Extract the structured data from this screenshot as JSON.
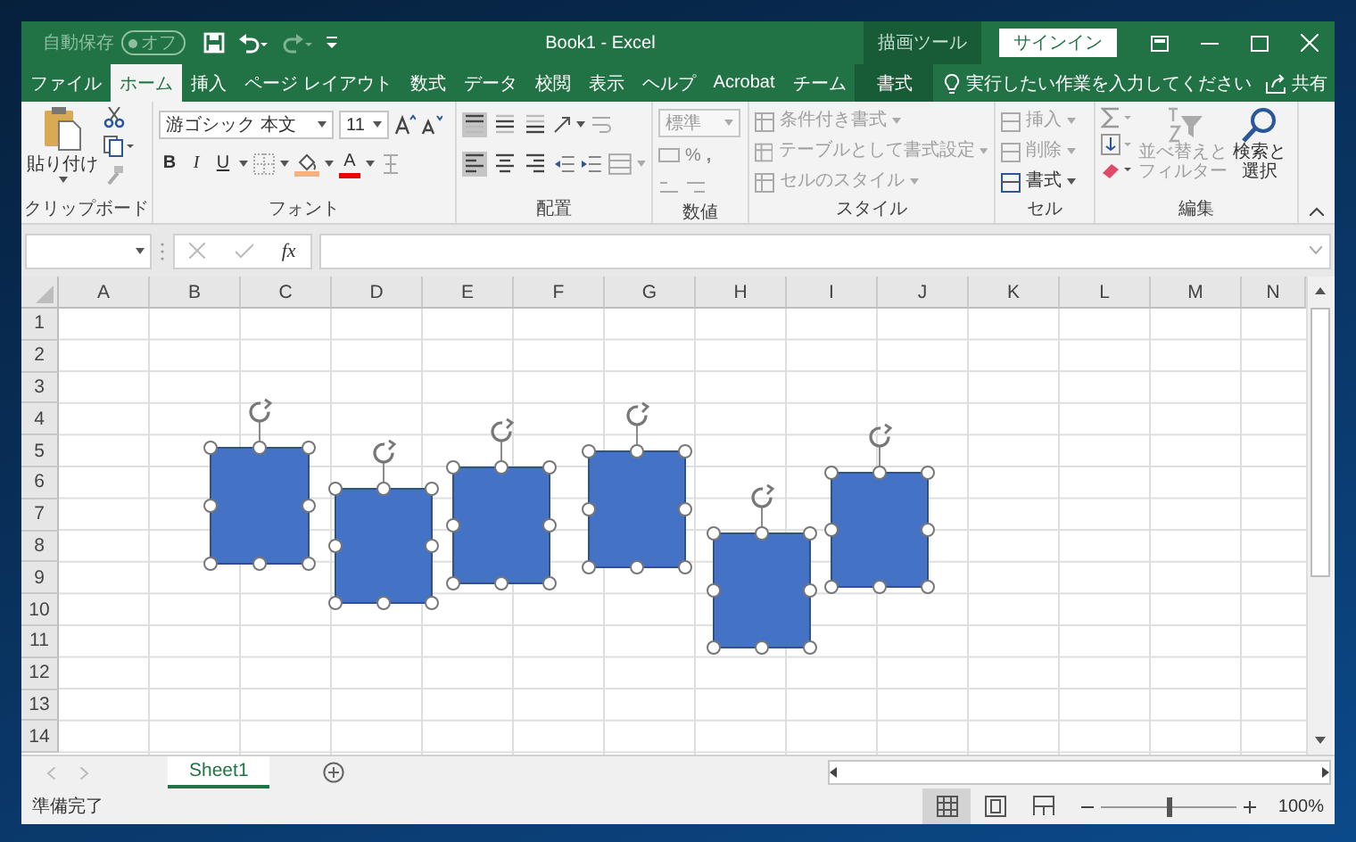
{
  "title_bar": {
    "autosave_label": "自動保存",
    "autosave_toggle": {
      "label": "オフ",
      "on": false
    },
    "title": "Book1  -  Excel",
    "context_group": "描画ツール",
    "signin": "サインイン"
  },
  "tabs": [
    {
      "label": "ファイル",
      "selected": false
    },
    {
      "label": "ホーム",
      "selected": true
    },
    {
      "label": "挿入",
      "selected": false
    },
    {
      "label": "ページ レイアウト",
      "selected": false
    },
    {
      "label": "数式",
      "selected": false
    },
    {
      "label": "データ",
      "selected": false
    },
    {
      "label": "校閲",
      "selected": false
    },
    {
      "label": "表示",
      "selected": false
    },
    {
      "label": "ヘルプ",
      "selected": false
    },
    {
      "label": "Acrobat",
      "selected": false
    },
    {
      "label": "チーム",
      "selected": false
    },
    {
      "label": "書式",
      "selected": false,
      "kind": "contextual"
    }
  ],
  "tell_me": {
    "placeholder": "実行したい作業を入力してください"
  },
  "share": "共有",
  "ribbon": {
    "clipboard": {
      "paste": "貼り付け",
      "label": "クリップボード"
    },
    "font": {
      "font_name": "游ゴシック 本文",
      "font_size": "11",
      "bold": "B",
      "italic": "I",
      "underline": "U",
      "font_color": "A",
      "label": "フォント"
    },
    "alignment": {
      "vertical": [
        {
          "selected": true
        },
        {
          "selected": false
        },
        {
          "selected": false
        }
      ],
      "horizontal": [
        {
          "selected": true
        },
        {
          "selected": false
        },
        {
          "selected": false
        }
      ],
      "label": "配置"
    },
    "number": {
      "format": "標準",
      "percent": "%",
      "comma": ",",
      "label": "数値"
    },
    "styles": {
      "items": [
        {
          "label": "条件付き書式",
          "disabled": true
        },
        {
          "label": "テーブルとして書式設定",
          "disabled": true
        },
        {
          "label": "セルのスタイル",
          "disabled": true
        }
      ],
      "label": "スタイル"
    },
    "cells": {
      "items": [
        {
          "label": "挿入",
          "disabled": true
        },
        {
          "label": "削除",
          "disabled": true
        },
        {
          "label": "書式",
          "disabled": false
        }
      ],
      "label": "セル"
    },
    "editing": {
      "sort": {
        "lines": [
          "並べ替えと",
          "フィルター"
        ],
        "disabled": true
      },
      "find": {
        "lines": [
          "検索と",
          "選択"
        ],
        "disabled": false
      },
      "label": "編集"
    }
  },
  "formula_bar": {
    "function_label": "fx"
  },
  "columns": [
    "A",
    "B",
    "C",
    "D",
    "E",
    "F",
    "G",
    "H",
    "I",
    "J",
    "K",
    "L",
    "M",
    "N"
  ],
  "rows": [
    "1",
    "2",
    "3",
    "4",
    "5",
    "6",
    "7",
    "8",
    "9",
    "10",
    "11",
    "12",
    "13",
    "14"
  ],
  "shapes": [
    {
      "selected": true
    },
    {
      "selected": true
    },
    {
      "selected": true
    },
    {
      "selected": true
    },
    {
      "selected": true
    },
    {
      "selected": true
    }
  ],
  "sheet_tabs": [
    {
      "label": "Sheet1",
      "selected": true
    }
  ],
  "status_bar": {
    "status": "準備完了",
    "views": [
      {
        "selected": true
      },
      {
        "selected": false
      },
      {
        "selected": false
      }
    ],
    "zoom": {
      "level": 0.5
    },
    "zoom_label": "100%"
  }
}
